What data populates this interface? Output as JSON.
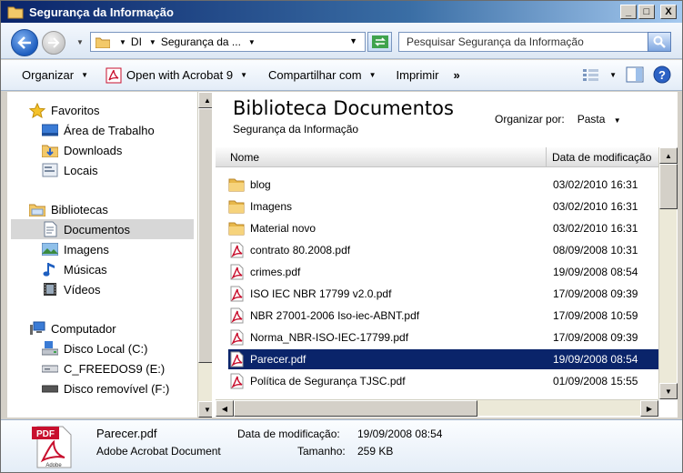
{
  "window": {
    "title": "Segurança da Informação",
    "buttons": [
      "_",
      "□",
      "X"
    ]
  },
  "address": {
    "crumbs": [
      "DI",
      "Segurança da ...",
      ""
    ],
    "search_placeholder": "Pesquisar Segurança da Informação"
  },
  "toolbar": {
    "organize": "Organizar",
    "open_with": "Open with Acrobat 9",
    "share": "Compartilhar com",
    "print": "Imprimir",
    "more": "»"
  },
  "nav": {
    "favorites": "Favoritos",
    "desktop": "Área de Trabalho",
    "downloads": "Downloads",
    "places": "Locais",
    "libraries": "Bibliotecas",
    "documents": "Documentos",
    "images": "Imagens",
    "music": "Músicas",
    "videos": "Vídeos",
    "computer": "Computador",
    "disk_c": "Disco Local (C:)",
    "disk_e": "C_FREEDOS9 (E:)",
    "disk_f": "Disco removível (F:)"
  },
  "content": {
    "library_title": "Biblioteca Documentos",
    "library_subtitle": "Segurança da Informação",
    "arrange_label": "Organizar por:",
    "arrange_value": "Pasta",
    "col_name": "Nome",
    "col_date": "Data de modificação",
    "rows": [
      {
        "name": "blog",
        "date": "03/02/2010 16:31",
        "type": "folder"
      },
      {
        "name": "Imagens",
        "date": "03/02/2010 16:31",
        "type": "folder"
      },
      {
        "name": "Material novo",
        "date": "03/02/2010 16:31",
        "type": "folder"
      },
      {
        "name": "contrato 80.2008.pdf",
        "date": "08/09/2008 10:31",
        "type": "pdf"
      },
      {
        "name": "crimes.pdf",
        "date": "19/09/2008 08:54",
        "type": "pdf"
      },
      {
        "name": "ISO IEC NBR 17799 v2.0.pdf",
        "date": "17/09/2008 09:39",
        "type": "pdf"
      },
      {
        "name": "NBR 27001-2006 Iso-iec-ABNT.pdf",
        "date": "17/09/2008 10:59",
        "type": "pdf"
      },
      {
        "name": "Norma_NBR-ISO-IEC-17799.pdf",
        "date": "17/09/2008 09:39",
        "type": "pdf"
      },
      {
        "name": "Parecer.pdf",
        "date": "19/09/2008 08:54",
        "type": "pdf"
      },
      {
        "name": "Política de Segurança TJSC.pdf",
        "date": "01/09/2008 15:55",
        "type": "pdf"
      }
    ],
    "selected_index": 8
  },
  "details": {
    "icon_label": "PDF",
    "icon_sublabel": "Adobe",
    "name": "Parecer.pdf",
    "type": "Adobe Acrobat Document",
    "modified_label": "Data de modificação:",
    "modified_value": "19/09/2008 08:54",
    "size_label": "Tamanho:",
    "size_value": "259 KB"
  },
  "colors": {
    "selection": "#0a246a",
    "title_bar": "#0a246a",
    "pdf_red": "#c8102e",
    "folder": "#e8b84a"
  }
}
